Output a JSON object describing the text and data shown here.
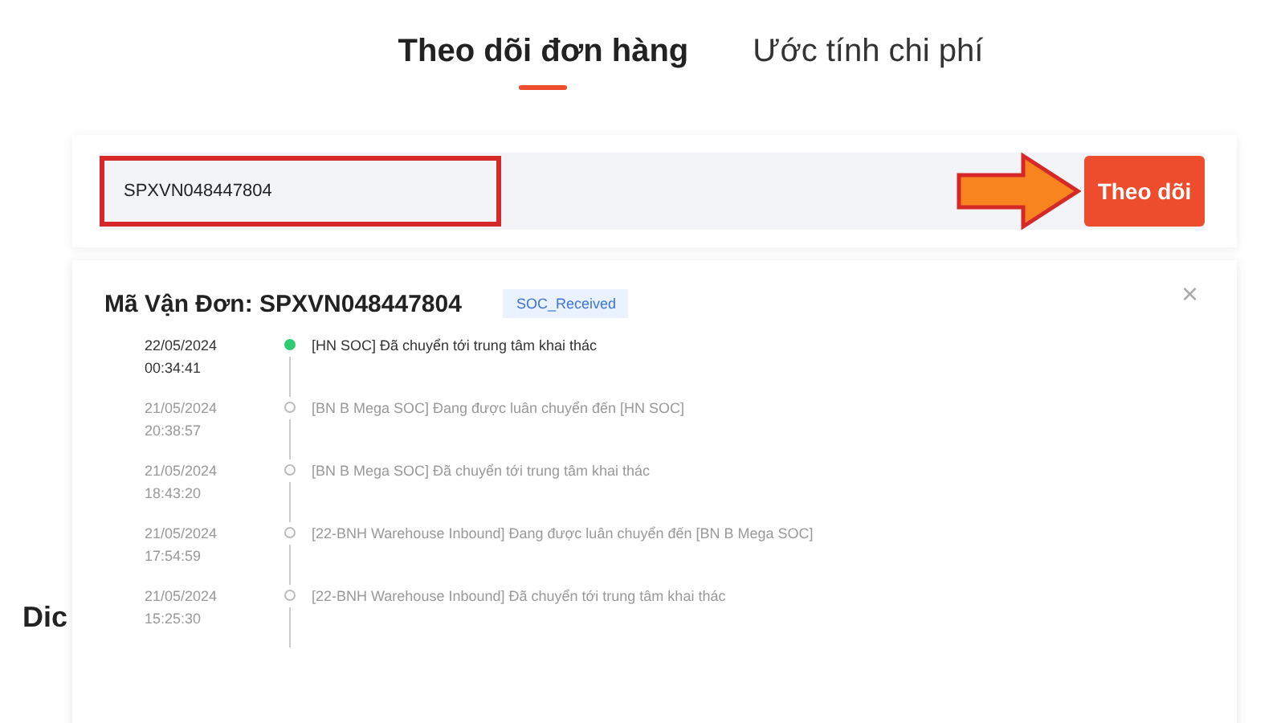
{
  "tabs": [
    {
      "label": "Theo dõi đơn hàng",
      "selected": true
    },
    {
      "label": "Ước tính chi phí",
      "selected": false
    }
  ],
  "search": {
    "value": "SPXVN048447804",
    "highlighted": true,
    "button": "Theo dõi"
  },
  "result": {
    "title": "Mã Vận Đơn: SPXVN048447804",
    "status": "SOC_Received",
    "close": "×",
    "events": [
      {
        "date": "22/05/2024",
        "time": "00:34:41",
        "text": "[HN SOC] Đã chuyển tới trung tâm khai thác",
        "current": true
      },
      {
        "date": "21/05/2024",
        "time": "20:38:57",
        "text": "[BN B Mega SOC] Đang được luân chuyển đến [HN SOC]",
        "current": false
      },
      {
        "date": "21/05/2024",
        "time": "18:43:20",
        "text": "[BN B Mega SOC] Đã chuyển tới trung tâm khai thác",
        "current": false
      },
      {
        "date": "21/05/2024",
        "time": "17:54:59",
        "text": "[22-BNH Warehouse Inbound] Đang được luân chuyển đến [BN B Mega SOC]",
        "current": false
      },
      {
        "date": "21/05/2024",
        "time": "15:25:30",
        "text": "[22-BNH Warehouse Inbound] Đã chuyển tới trung tâm khai thác",
        "current": false
      }
    ]
  },
  "side_heading": "Dic"
}
